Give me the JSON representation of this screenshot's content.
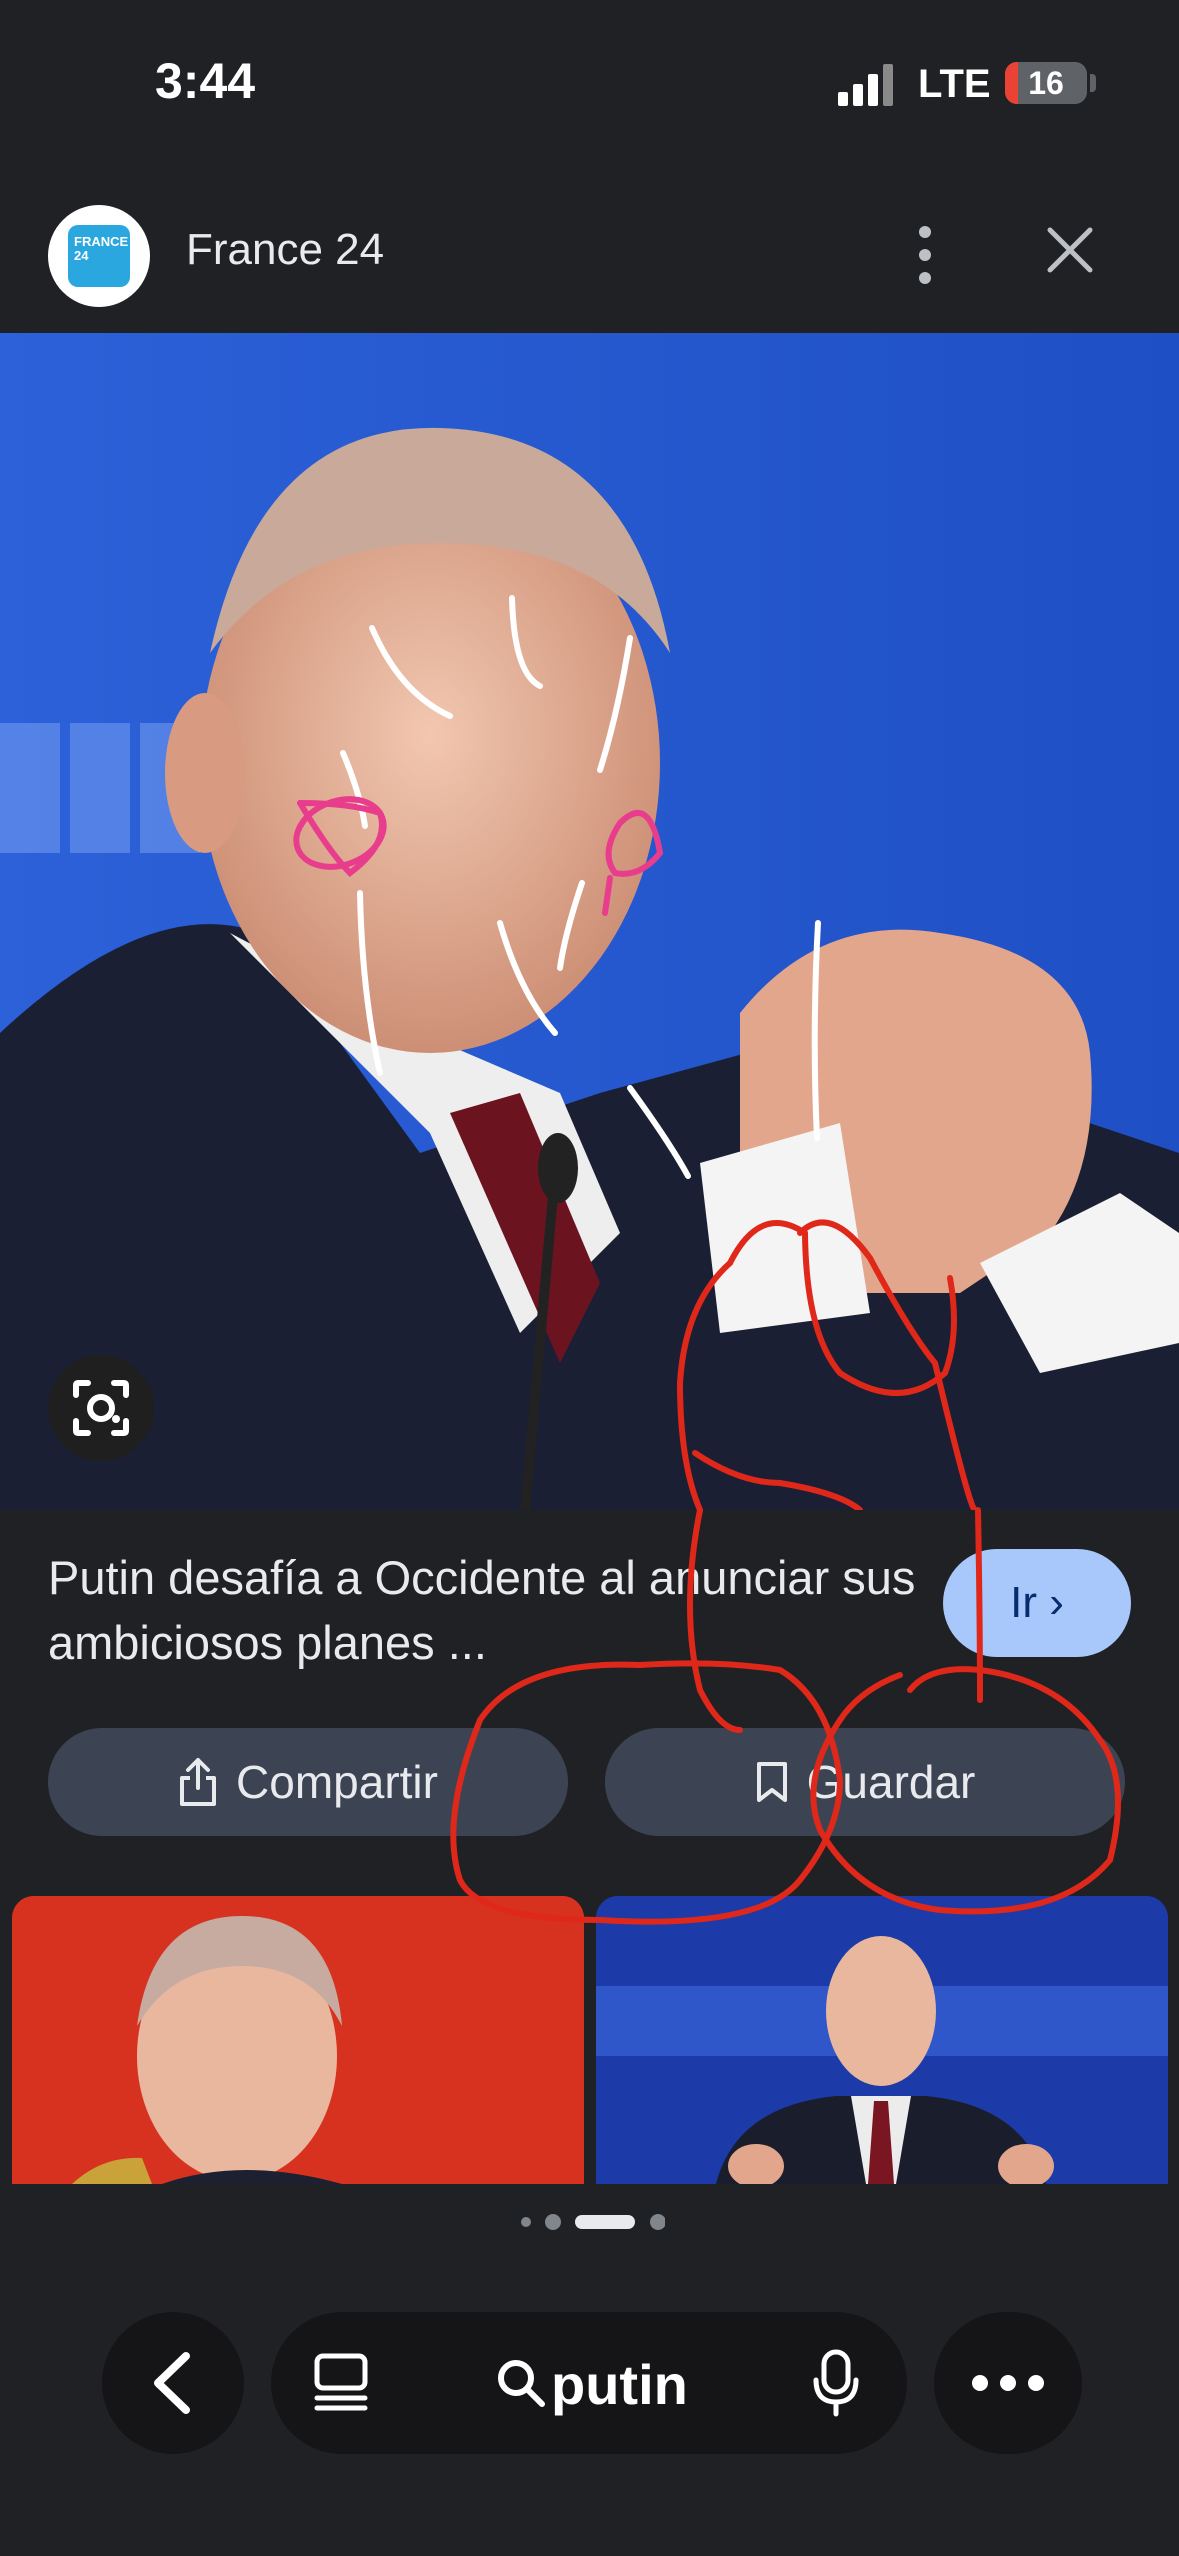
{
  "status_bar": {
    "time": "3:44",
    "network": "LTE",
    "battery_level": "16",
    "battery_fraction": 0.16
  },
  "source": {
    "name": "France 24",
    "logo_text": "FRANCE 24"
  },
  "result": {
    "title": "Putin desafía a Occidente al anunciar sus ambiciosos planes ...",
    "go_label": "Ir",
    "share_label": "Compartir",
    "save_label": "Guardar"
  },
  "pagination": {
    "total": 4,
    "active_index": 2
  },
  "bottom_bar": {
    "query": "putin"
  },
  "colors": {
    "background": "#202124",
    "button": "#3c4454",
    "go_button": "#a8c7fa",
    "annotation_red": "#e0281a",
    "annotation_pink": "#e83d8c"
  }
}
